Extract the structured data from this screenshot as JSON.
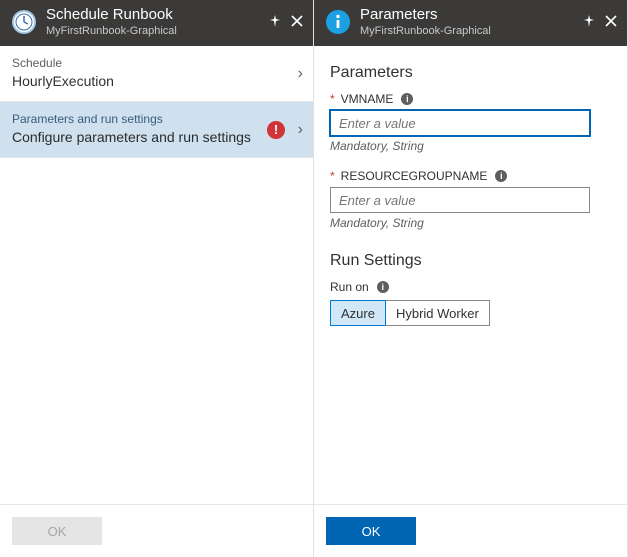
{
  "left": {
    "title": "Schedule Runbook",
    "subtitle": "MyFirstRunbook-Graphical",
    "rows": [
      {
        "label": "Schedule",
        "value": "HourlyExecution"
      },
      {
        "label": "Parameters and run settings",
        "value": "Configure parameters and run settings"
      }
    ],
    "ok": "OK",
    "error_badge": "!"
  },
  "right": {
    "title": "Parameters",
    "subtitle": "MyFirstRunbook-Graphical",
    "section_params": "Parameters",
    "fields": [
      {
        "label": "VMNAME",
        "placeholder": "Enter a value",
        "hint": "Mandatory, String"
      },
      {
        "label": "RESOURCEGROUPNAME",
        "placeholder": "Enter a value",
        "hint": "Mandatory, String"
      }
    ],
    "section_run": "Run Settings",
    "run_on_label": "Run on",
    "run_options": [
      "Azure",
      "Hybrid Worker"
    ],
    "ok": "OK"
  },
  "glyphs": {
    "asterisk": "*",
    "info": "i",
    "chevron": "›"
  }
}
